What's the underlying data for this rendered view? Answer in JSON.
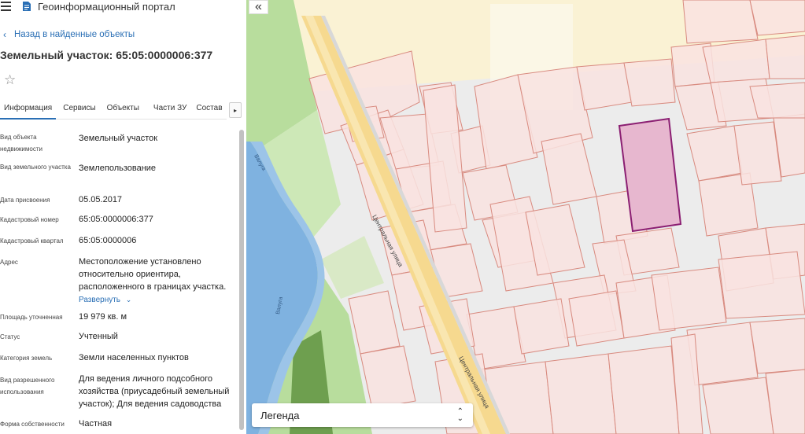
{
  "app": {
    "portal_title": "Геоинформационный портал"
  },
  "panel": {
    "back_label": "Назад в найденные объекты",
    "object_title": "Земельный участок: 65:05:0000006:377",
    "tabs": [
      {
        "label": "Информация",
        "active": true
      },
      {
        "label": "Сервисы",
        "active": false
      },
      {
        "label": "Объекты",
        "active": false
      },
      {
        "label": "Части ЗУ",
        "active": false
      },
      {
        "label": "Состав",
        "active": false
      }
    ],
    "attributes": {
      "object_type": {
        "label": "Вид объекта недвижимости",
        "value": "Земельный участок"
      },
      "land_type": {
        "label": "Вид земельного участка",
        "value": "Землепользование"
      },
      "date": {
        "label": "Дата присвоения",
        "value": "05.05.2017"
      },
      "cadastral_number": {
        "label": "Кадастровый номер",
        "value": "65:05:0000006:377"
      },
      "cadastral_quarter": {
        "label": "Кадастровый квартал",
        "value": "65:05:0000006"
      },
      "address": {
        "label": "Адрес",
        "value": "Местоположение установлено относительно ориентира, расположенного в границах участка.",
        "expand_label": "Развернуть"
      },
      "area": {
        "label": "Площадь уточненная",
        "value": "19 979 кв. м"
      },
      "status": {
        "label": "Статус",
        "value": "Учтенный"
      },
      "land_category": {
        "label": "Категория земель",
        "value": "Земли населенных пунктов"
      },
      "permitted_use": {
        "label": "Вид разрешенного использования",
        "value": "Для ведения личного подсобного хозяйства (приусадебный земельный участок); Для ведения садоводства"
      },
      "ownership": {
        "label": "Форма собственности",
        "value": "Частная"
      }
    }
  },
  "map": {
    "collapse_icon": "double-chevron-left-icon",
    "street_label": "Центральная улица",
    "river_label": "Валуга",
    "legend_label": "Легенда",
    "colors": {
      "zone": "#faf2d4",
      "plot_fill": "#f9e3e0",
      "plot_stroke": "#d88a7f",
      "selected_fill": "#e7b7cf",
      "selected_stroke": "#8b1f72",
      "road": "#f6d98f",
      "river": "#7fb2e0",
      "green": "#b8dd9d"
    }
  }
}
